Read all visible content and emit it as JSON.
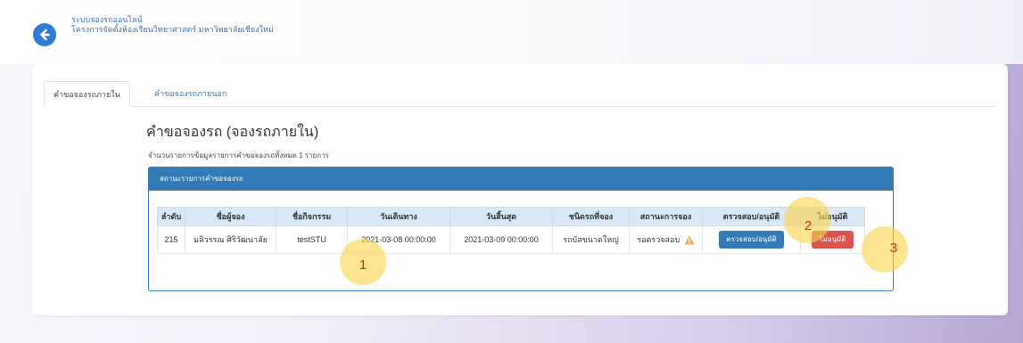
{
  "header": {
    "title": "ระบบจองรถออนไลน์",
    "subtitle": "โครงการจัดตั้งห้องเรียนวิทยาศาสตร์ มหาวิทยาลัยเชียงใหม่"
  },
  "tabs": [
    {
      "label": "คำขอจองรถภายใน",
      "active": true
    },
    {
      "label": "คำขอจองรถภายนอก",
      "active": false
    }
  ],
  "main": {
    "heading": "คำขอจองรถ (จองรถภายใน)",
    "count_text": "จำนวนรายการข้อมูลรายการคำขอจองรถทั้งหมด 1 รายการ",
    "panel_title": "สถานะรายการคำขอจองรถ"
  },
  "table": {
    "headers": [
      "ลำดับ",
      "ชื่อผู้จอง",
      "ชื่อกิจกรรม",
      "วันเดินทาง",
      "วันสิ้นสุด",
      "ชนิดรถที่จอง",
      "สถานะการจอง",
      "ตรวจสอบ/อนุมัติ",
      "ไม่อนุมัติ"
    ],
    "rows": [
      {
        "id": "215",
        "name": "มลิวรรณ ศิริวัฒนาลัย",
        "activity": "testSTU",
        "start": "2021-03-08 00:00:00",
        "end": "2021-03-09 00:00:00",
        "vehicle": "รถบัสขนาดใหญ่",
        "status": "รอตรวจสอบ",
        "approve_label": "ตรวจสอบ/อนุมัติ",
        "reject_label": "ไม่อนุมัติ"
      }
    ]
  },
  "markers": [
    "1",
    "2",
    "3"
  ],
  "colors": {
    "primary": "#337ab7",
    "danger": "#d9534f",
    "warning": "#f0ad4e",
    "marker": "#fcd34d"
  }
}
